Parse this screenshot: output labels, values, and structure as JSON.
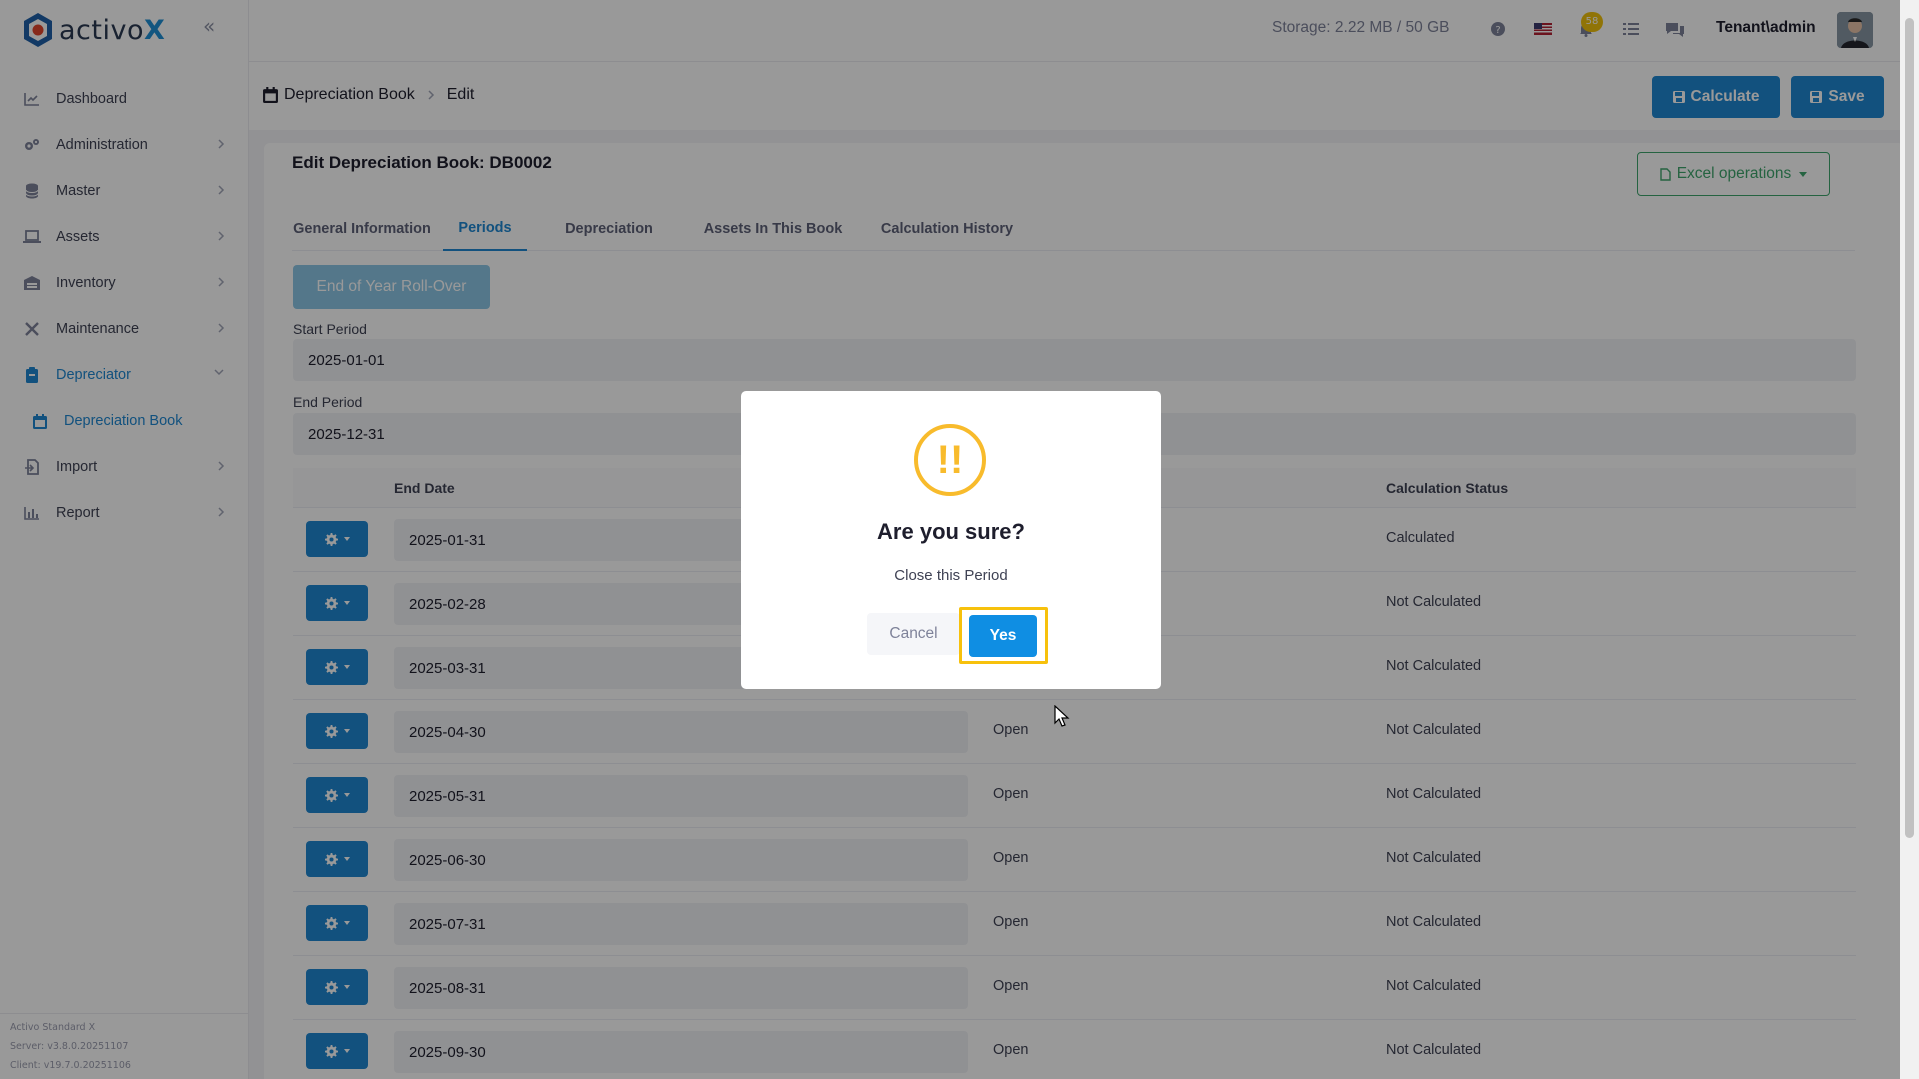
{
  "app": {
    "logo_text_main": "activo",
    "logo_text_accent": "X"
  },
  "sidebar": {
    "items": [
      {
        "label": "Dashboard",
        "icon": "chart-line-icon"
      },
      {
        "label": "Administration",
        "icon": "gears-icon"
      },
      {
        "label": "Master",
        "icon": "database-icon"
      },
      {
        "label": "Assets",
        "icon": "laptop-icon"
      },
      {
        "label": "Inventory",
        "icon": "warehouse-icon"
      },
      {
        "label": "Maintenance",
        "icon": "tools-icon"
      },
      {
        "label": "Depreciator",
        "icon": "clipboard-icon"
      },
      {
        "label": "Depreciation Book",
        "icon": "calendar-icon"
      },
      {
        "label": "Import",
        "icon": "file-import-icon"
      },
      {
        "label": "Report",
        "icon": "chart-bar-icon"
      }
    ],
    "version": {
      "product": "Activo Standard X",
      "server": "Server: v3.8.0.20251107",
      "client": "Client: v19.7.0.20251106"
    }
  },
  "header": {
    "storage": "Storage: 2.22 MB / 50 GB",
    "notification_count": "58",
    "user": "Tenant\\admin"
  },
  "toolbar": {
    "breadcrumb_root": "Depreciation Book",
    "breadcrumb_current": "Edit",
    "calculate_label": "Calculate",
    "save_label": "Save"
  },
  "card": {
    "title": "Edit Depreciation Book: DB0002",
    "excel_label": "Excel operations",
    "tabs": [
      "General Information",
      "Periods",
      "Depreciation",
      "Assets In This Book",
      "Calculation History"
    ],
    "active_tab": "Periods",
    "eoy_label": "End of Year Roll-Over",
    "start_period_label": "Start Period",
    "start_period_value": "2025-01-01",
    "end_period_label": "End Period",
    "end_period_value": "2025-12-31"
  },
  "table": {
    "headers": {
      "end_date": "End Date",
      "calc_status": "Calculation Status"
    },
    "rows": [
      {
        "end_date": "2025-01-31",
        "status": "",
        "calc": "Calculated"
      },
      {
        "end_date": "2025-02-28",
        "status": "",
        "calc": "Not Calculated"
      },
      {
        "end_date": "2025-03-31",
        "status": "",
        "calc": "Not Calculated"
      },
      {
        "end_date": "2025-04-30",
        "status": "Open",
        "calc": "Not Calculated"
      },
      {
        "end_date": "2025-05-31",
        "status": "Open",
        "calc": "Not Calculated"
      },
      {
        "end_date": "2025-06-30",
        "status": "Open",
        "calc": "Not Calculated"
      },
      {
        "end_date": "2025-07-31",
        "status": "Open",
        "calc": "Not Calculated"
      },
      {
        "end_date": "2025-08-31",
        "status": "Open",
        "calc": "Not Calculated"
      },
      {
        "end_date": "2025-09-30",
        "status": "Open",
        "calc": "Not Calculated"
      }
    ]
  },
  "modal": {
    "icon_text": "!!",
    "title": "Are you sure?",
    "text": "Close this Period",
    "cancel_label": "Cancel",
    "yes_label": "Yes"
  },
  "colors": {
    "primary": "#1e88d2",
    "warning": "#f8bb2c",
    "highlight": "#f7c10c",
    "success": "#3fa56d"
  }
}
